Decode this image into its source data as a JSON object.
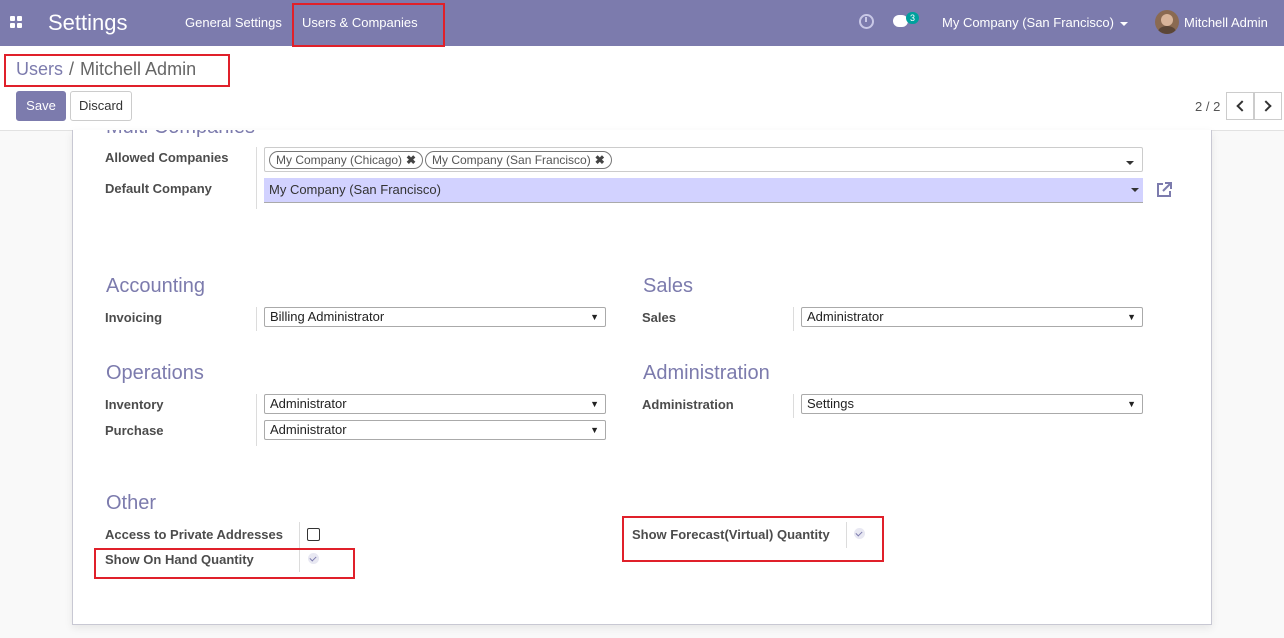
{
  "navbar": {
    "app_title": "Settings",
    "menu": [
      "General Settings",
      "Users & Companies"
    ],
    "chat_badge": "3",
    "company": "My Company (San Francisco)",
    "user": "Mitchell Admin"
  },
  "breadcrumb": {
    "parent": "Users",
    "separator": "/",
    "current": "Mitchell Admin"
  },
  "buttons": {
    "save": "Save",
    "discard": "Discard"
  },
  "pager": {
    "value": "2 / 2"
  },
  "form": {
    "partial_section_title": "Multi Companies",
    "allowed_companies_label": "Allowed Companies",
    "allowed_companies": [
      "My Company (Chicago)",
      "My Company (San Francisco)"
    ],
    "default_company_label": "Default Company",
    "default_company": "My Company (San Francisco)",
    "accounting": {
      "title": "Accounting",
      "invoicing_label": "Invoicing",
      "invoicing_value": "Billing Administrator"
    },
    "sales": {
      "title": "Sales",
      "sales_label": "Sales",
      "sales_value": "Administrator"
    },
    "operations": {
      "title": "Operations",
      "inventory_label": "Inventory",
      "inventory_value": "Administrator",
      "purchase_label": "Purchase",
      "purchase_value": "Administrator"
    },
    "administration": {
      "title": "Administration",
      "admin_label": "Administration",
      "admin_value": "Settings"
    },
    "other": {
      "title": "Other",
      "private_addresses_label": "Access to Private Addresses",
      "private_addresses_checked": false,
      "on_hand_label": "Show On Hand Quantity",
      "on_hand_checked": true,
      "forecast_label": "Show Forecast(Virtual) Quantity",
      "forecast_checked": true
    }
  },
  "colors": {
    "brand": "#7c7bad",
    "highlight": "#e0202a",
    "default_company_bg": "#d2d2ff"
  }
}
